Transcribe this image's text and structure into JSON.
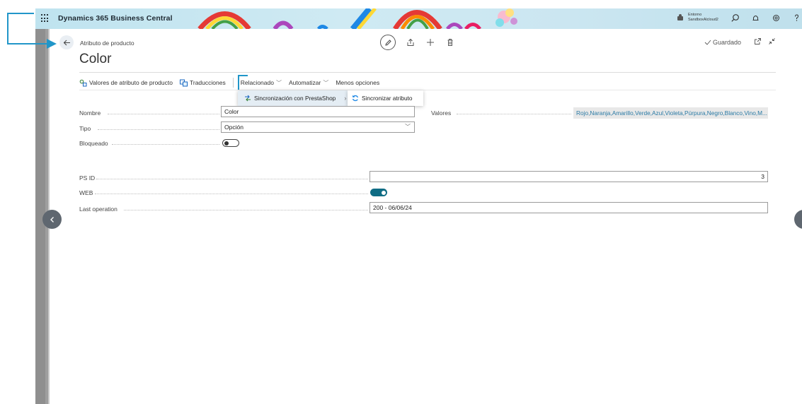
{
  "app": {
    "title": "Dynamics 365 Business Central",
    "environment_label": "Entorno",
    "environment_name": "SandboxAlcloud2"
  },
  "page": {
    "caption": "Atributo de producto",
    "title": "Color",
    "saved_status": "Guardado"
  },
  "actionbar": {
    "items": [
      "Valores de atributo de producto",
      "Traducciones",
      "Relacionado",
      "Automatizar",
      "Menos opciones"
    ]
  },
  "menus": {
    "related_submenu": "Sincronización con PrestaShop",
    "sync_action": "Sincronizar atributo"
  },
  "fields": {
    "nombre": {
      "label": "Nombre",
      "value": "Color"
    },
    "tipo": {
      "label": "Tipo",
      "value": "Opción"
    },
    "bloqueado": {
      "label": "Bloqueado",
      "on": false
    },
    "valores": {
      "label": "Valores",
      "value": "Rojo,Naranja,Amarillo,Verde,Azul,Violeta,Púrpura,Negro,Blanco,Vino,M..."
    },
    "ps_id": {
      "label": "PS ID",
      "value": "3"
    },
    "web": {
      "label": "WEB",
      "on": true
    },
    "last_operation": {
      "label": "Last operation",
      "value": "200 - 06/06/24"
    }
  },
  "colors": {
    "accent": "#0f6c84",
    "callout": "#2196c9",
    "topbar": "#cbe6f1"
  },
  "icons": {
    "waffle": "waffle-icon",
    "environment": "environment-icon",
    "search": "search-icon",
    "bell": "bell-icon",
    "settings": "gear-icon",
    "help": "help-icon",
    "back": "back-arrow-icon",
    "edit": "pencil-icon",
    "share": "share-icon",
    "new": "plus-icon",
    "delete": "trash-icon",
    "open_new_window": "open-new-window-icon",
    "collapse": "collapse-icon",
    "sync": "sync-icon"
  }
}
